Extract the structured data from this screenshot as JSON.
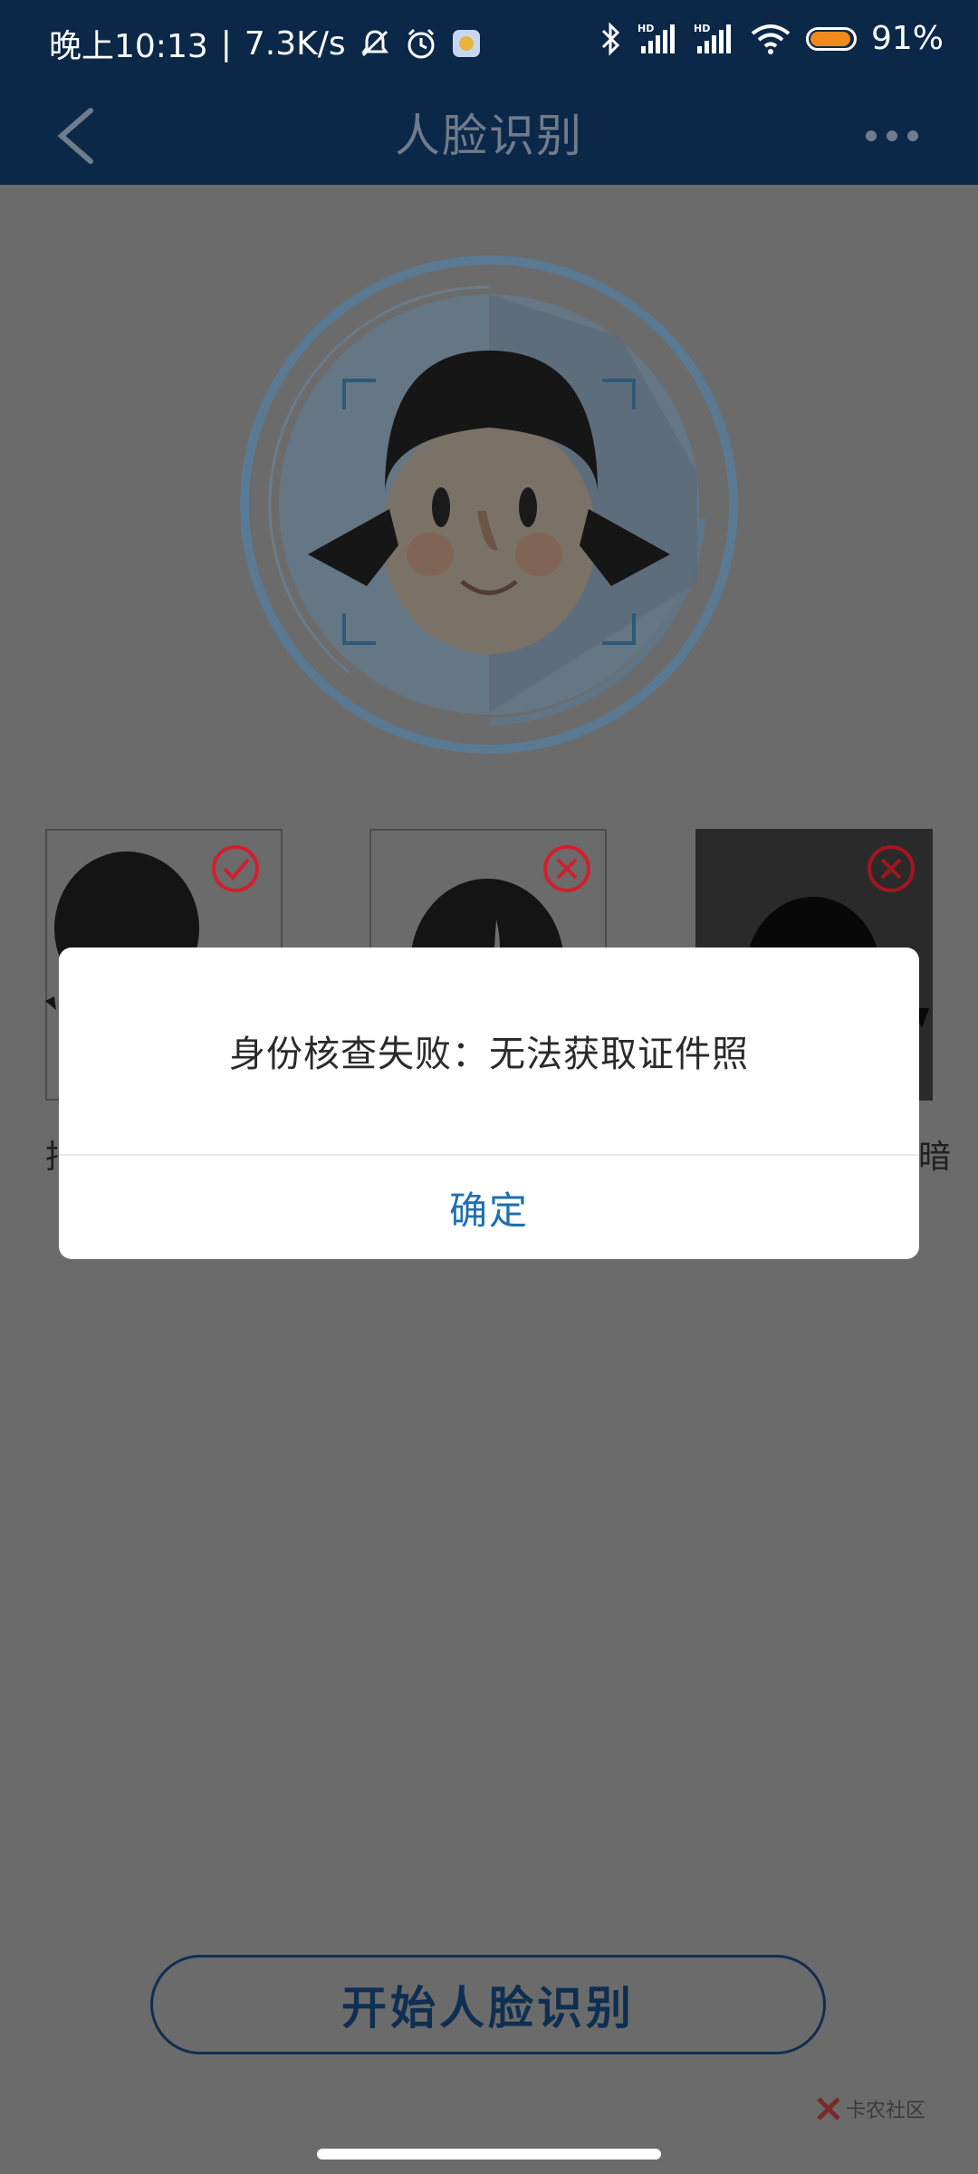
{
  "status_bar": {
    "time": "晚上10:13",
    "net_speed": "7.3K/s",
    "battery": "91%",
    "battery_level": 0.91,
    "icons": [
      "mute-icon",
      "alarm-icon",
      "app-notification-icon",
      "bluetooth-icon",
      "hd-signal-icon",
      "hd-signal-icon",
      "wifi-icon",
      "battery-icon"
    ]
  },
  "app_bar": {
    "title": "人脸识别",
    "back_icon": "chevron-left-icon",
    "more_icon": "more-dots-icon"
  },
  "examples": [
    {
      "status": "correct",
      "icon": "check-circle-icon",
      "caption": "拍"
    },
    {
      "status": "wrong",
      "icon": "x-circle-icon",
      "caption": ""
    },
    {
      "status": "wrong",
      "icon": "x-circle-icon",
      "caption": "暗"
    }
  ],
  "dialog": {
    "message": "身份核查失败：无法获取证件照",
    "ok_label": "确定"
  },
  "start_button": "开始人脸识别",
  "watermark": "卡农社区",
  "colors": {
    "header_bg": "#0c2848",
    "overlay_bg": "#6b6b6b",
    "accent_blue": "#1f6fb2",
    "error_red": "#d0202e"
  }
}
